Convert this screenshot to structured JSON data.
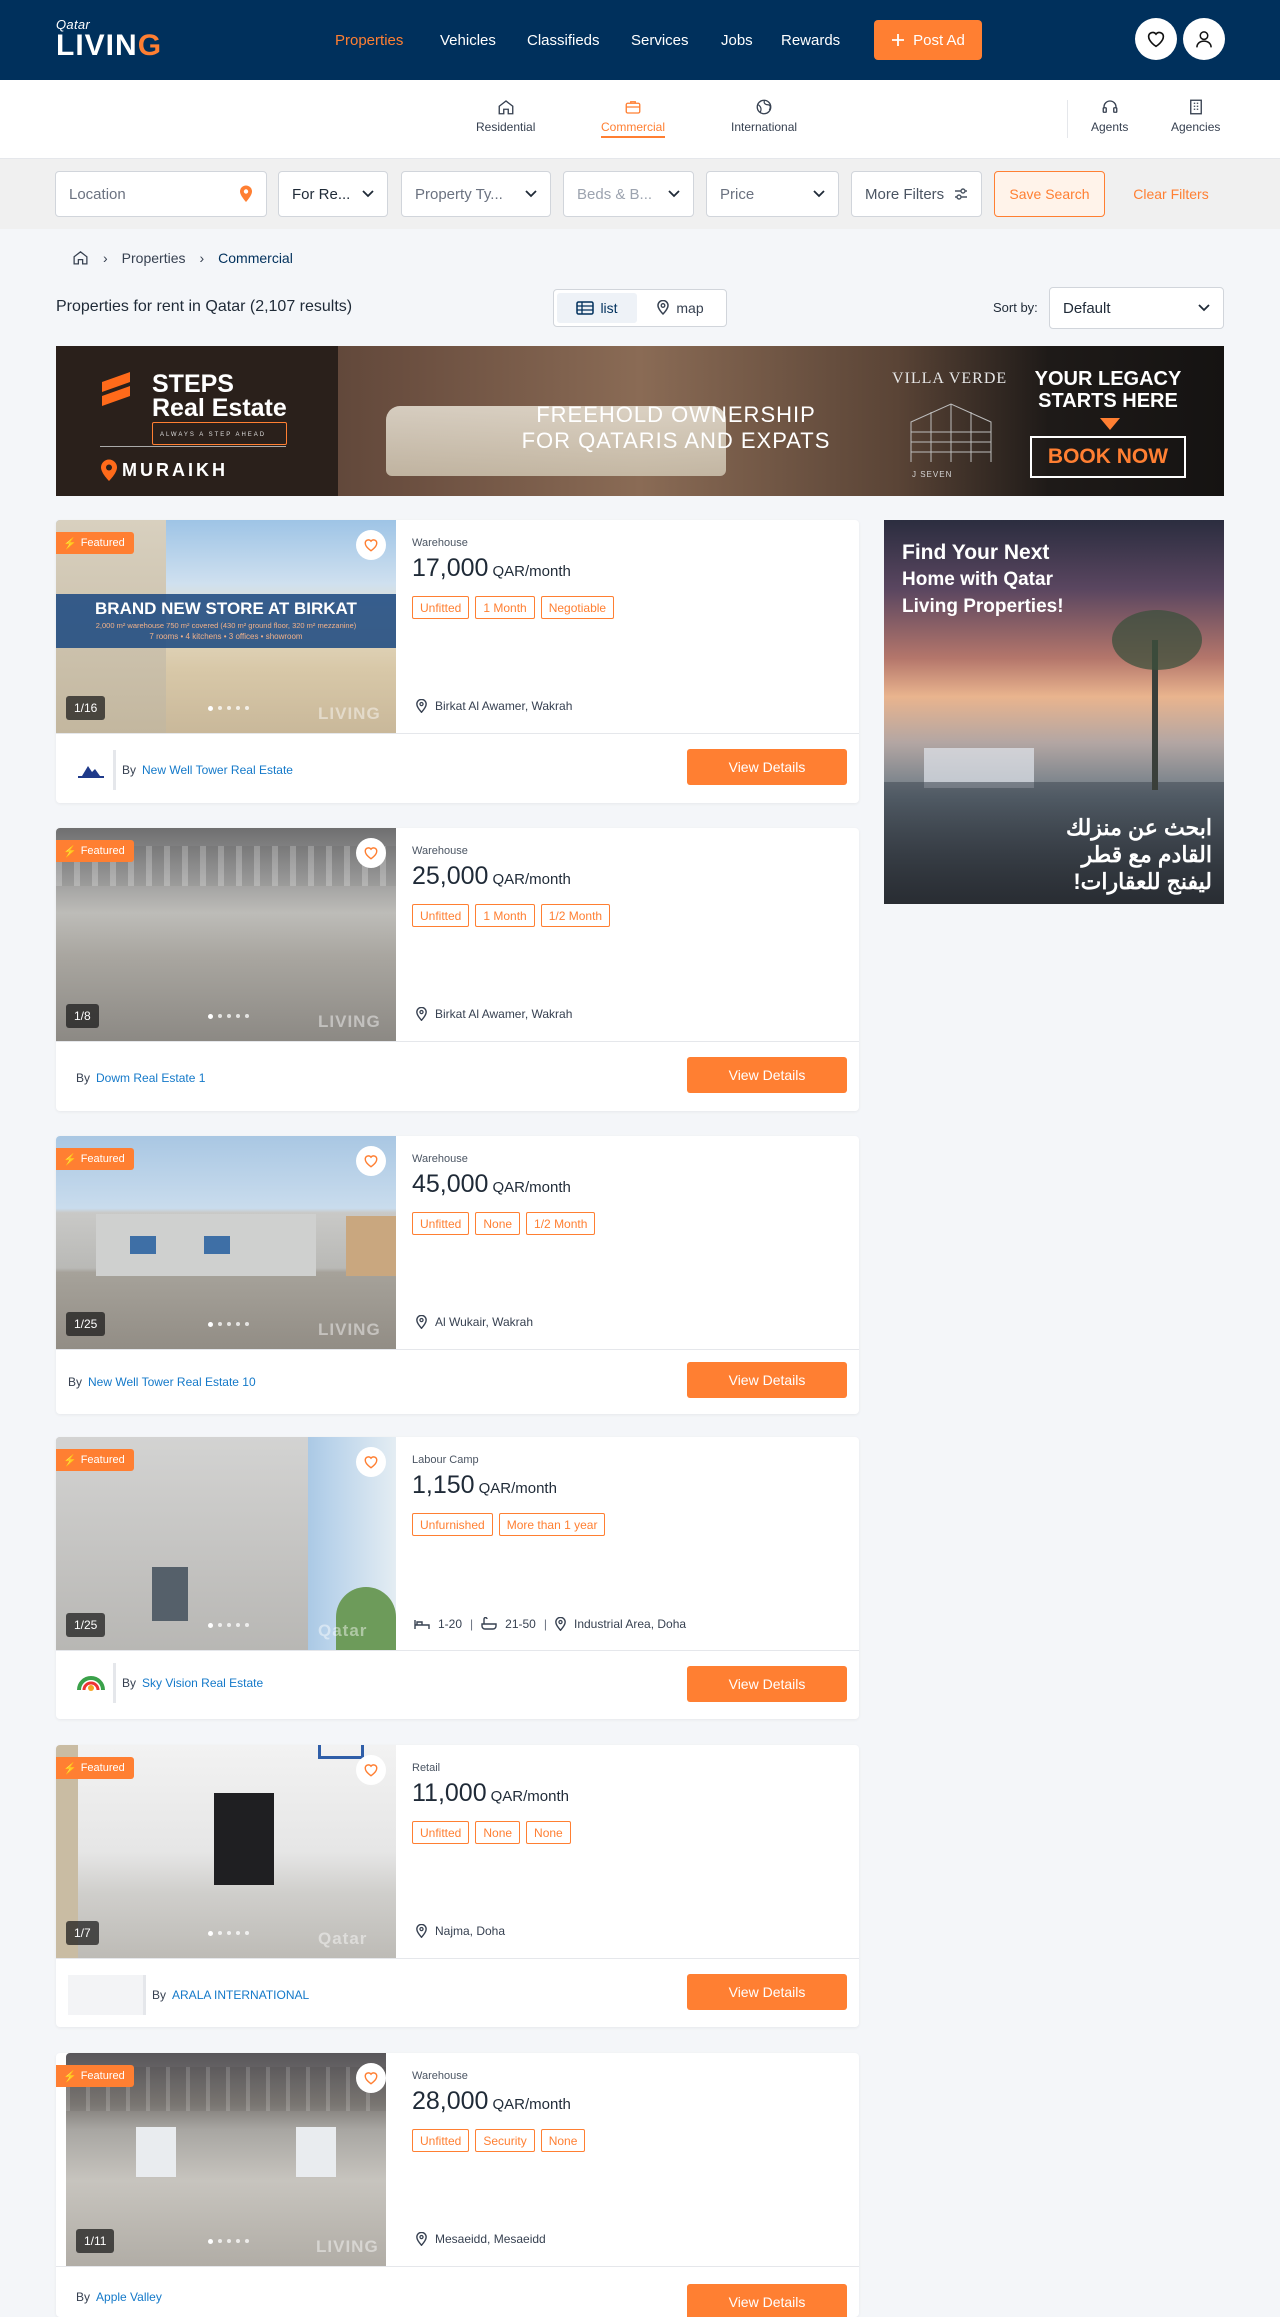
{
  "header": {
    "logo_small": "Qatar",
    "logo_big_a": "LIVI",
    "logo_big_b": "N",
    "logo_big_c": "G",
    "nav": [
      "Properties",
      "Vehicles",
      "Classifieds",
      "Services",
      "Jobs",
      "Rewards"
    ],
    "post_ad": "Post Ad",
    "accent": "#ff7f32",
    "brand": "#00305c"
  },
  "subnav": {
    "tabs": [
      "Residential",
      "Commercial",
      "International"
    ],
    "right": [
      "Agents",
      "Agencies"
    ]
  },
  "filters": {
    "location_placeholder": "Location",
    "for_rent": "For Re...",
    "property_type": "Property Ty...",
    "beds_baths": "Beds & B...",
    "price": "Price",
    "more_filters": "More Filters",
    "save_search": "Save Search",
    "clear_filters": "Clear Filters"
  },
  "breadcrumb": [
    "Properties",
    "Commercial"
  ],
  "results": {
    "title": "Properties for rent in Qatar (2,107 results)",
    "view_list": "list",
    "view_map": "map",
    "sort_label": "Sort by:",
    "sort_value": "Default"
  },
  "banner": {
    "brand_a": "STEPS",
    "brand_b": "Real Estate",
    "brand_tag": "ALWAYS A STEP AHEAD",
    "location": "MURAIKH",
    "headline_1": "FREEHOLD OWNERSHIP",
    "headline_2": "FOR QATARIS AND EXPATS",
    "project": "VILLA VERDE",
    "project_sub": "J SEVEN",
    "legacy_1": "YOUR LEGACY",
    "legacy_2": "STARTS HERE",
    "cta": "BOOK NOW"
  },
  "listings": [
    {
      "featured": "Featured",
      "counter": "1/16",
      "category": "Warehouse",
      "price": "17,000",
      "unit": "QAR/month",
      "tags": [
        "Unfitted",
        "1 Month",
        "Negotiable"
      ],
      "location": "Birkat Al Awamer, Wakrah",
      "by": "By",
      "agency": "New Well Tower Real Estate",
      "cta": "View Details",
      "overlay_title": "BRAND NEW STORE AT BIRKAT",
      "overlay_sub_1": "2,000 m² warehouse 750 m² covered (430 m² ground floor, 320 m² mezzanine)",
      "overlay_sub_2": "7 rooms • 4 kitchens • 3 offices • showroom",
      "watermark": "LIVING"
    },
    {
      "featured": "Featured",
      "counter": "1/8",
      "category": "Warehouse",
      "price": "25,000",
      "unit": "QAR/month",
      "tags": [
        "Unfitted",
        "1 Month",
        "1/2 Month"
      ],
      "location": "Birkat Al Awamer, Wakrah",
      "by": "By",
      "agency": "Dowm Real Estate 1",
      "cta": "View Details",
      "watermark": "LIVING"
    },
    {
      "featured": "Featured",
      "counter": "1/25",
      "category": "Warehouse",
      "price": "45,000",
      "unit": "QAR/month",
      "tags": [
        "Unfitted",
        "None",
        "1/2 Month"
      ],
      "location": "Al Wukair, Wakrah",
      "by": "By",
      "agency": "New Well Tower Real Estate 10",
      "cta": "View Details",
      "watermark": "LIVING"
    },
    {
      "featured": "Featured",
      "counter": "1/25",
      "category": "Labour Camp",
      "price": "1,150",
      "unit": "QAR/month",
      "tags": [
        "Unfurnished",
        "More than 1 year"
      ],
      "beds": "1-20",
      "baths": "21-50",
      "location": "Industrial Area, Doha",
      "by": "By",
      "agency": "Sky Vision Real Estate",
      "cta": "View Details",
      "watermark": "Qatar"
    },
    {
      "featured": "Featured",
      "counter": "1/7",
      "category": "Retail",
      "price": "11,000",
      "unit": "QAR/month",
      "tags": [
        "Unfitted",
        "None",
        "None"
      ],
      "location": "Najma, Doha",
      "by": "By",
      "agency": "ARALA INTERNATIONAL",
      "cta": "View Details",
      "watermark": "Qatar"
    },
    {
      "featured": "Featured",
      "counter": "1/11",
      "category": "Warehouse",
      "price": "28,000",
      "unit": "QAR/month",
      "tags": [
        "Unfitted",
        "Security",
        "None"
      ],
      "location": "Mesaeidd, Mesaeidd",
      "by": "By",
      "agency": "Apple Valley",
      "cta": "View Details",
      "watermark": "LIVING"
    }
  ],
  "promo": {
    "title_1": "Find Your Next",
    "title_2": "Home with Qatar",
    "title_3": "Living Properties!",
    "ar_1": "ابحث عن منزلك",
    "ar_2": "القادم مع قطر",
    "ar_3": "ليفنج للعقارات!"
  }
}
